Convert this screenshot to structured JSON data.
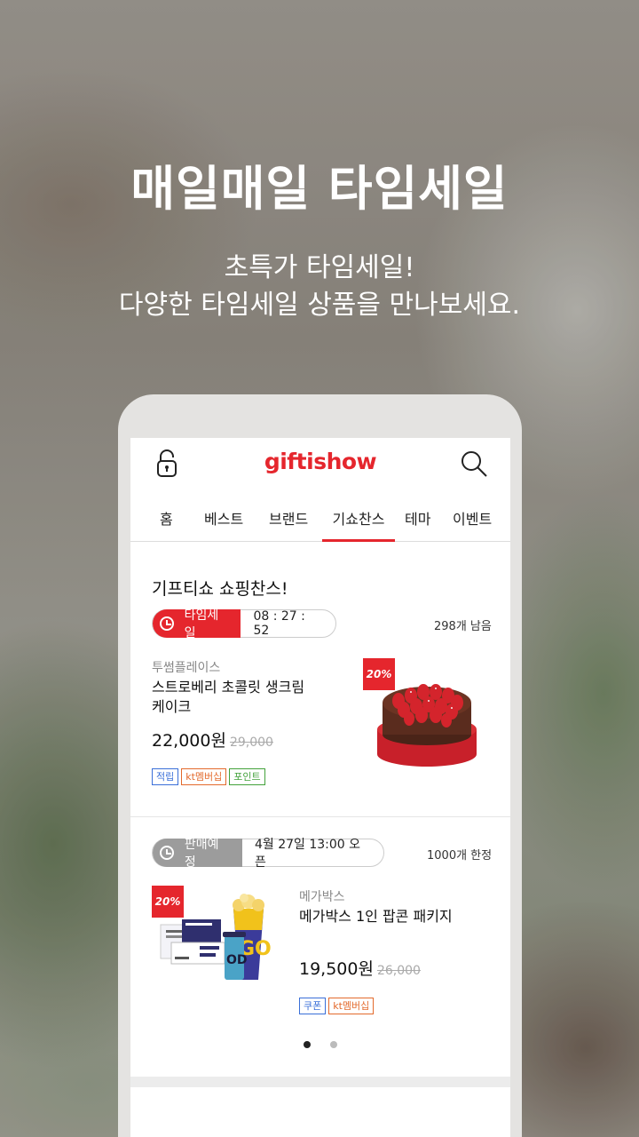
{
  "promo": {
    "headline": "매일매일 타임세일",
    "sub_line1": "초특가 타임세일!",
    "sub_line2": "다양한 타임세일 상품을 만나보세요."
  },
  "app": {
    "logo": "giftishow",
    "accent_color": "#e5262d",
    "tabs": [
      {
        "label": "홈",
        "active": false
      },
      {
        "label": "베스트",
        "active": false
      },
      {
        "label": "브랜드",
        "active": false
      },
      {
        "label": "기쇼찬스",
        "active": true
      },
      {
        "label": "테마",
        "active": false
      },
      {
        "label": "이벤트",
        "active": false
      }
    ]
  },
  "section": {
    "title": "기프티쇼 쇼핑찬스!",
    "deal1": {
      "status_label": "타임세일",
      "timer": "08 : 27 : 52",
      "stock": "298개 남음",
      "brand": "투썸플레이스",
      "name_line1": "스트로베리 초콜릿 생크림",
      "name_line2": "케이크",
      "price": "22,000원",
      "original_price": "29,000",
      "discount": "20%",
      "tags": [
        "적립",
        "kt멤버십",
        "포인트"
      ]
    },
    "deal2": {
      "status_label": "판매예정",
      "open_time": "4월 27일 13:00 오픈",
      "stock": "1000개 한정",
      "brand": "메가박스",
      "name": "메가박스 1인 팝콘 패키지",
      "price": "19,500원",
      "original_price": "26,000",
      "discount": "20%",
      "tags": [
        "쿠폰",
        "kt멤버십"
      ]
    }
  }
}
